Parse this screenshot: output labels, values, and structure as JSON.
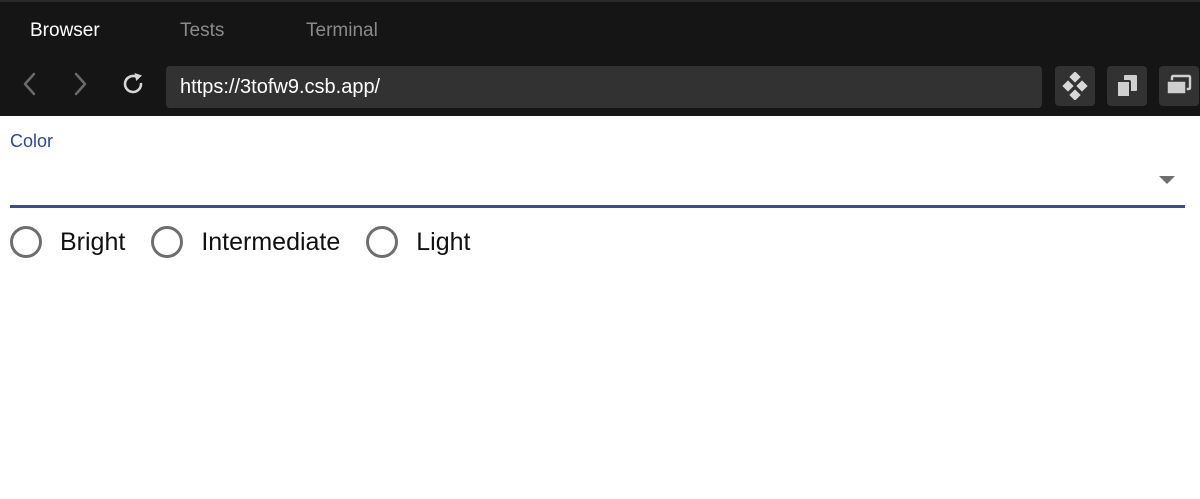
{
  "tabs": {
    "browser": "Browser",
    "tests": "Tests",
    "terminal": "Terminal"
  },
  "navbar": {
    "url": "https://3tofw9.csb.app/"
  },
  "form": {
    "color_label": "Color",
    "select_value": "",
    "radio_options": [
      "Bright",
      "Intermediate",
      "Light"
    ]
  },
  "colors": {
    "accent": "#3949ab",
    "chrome_bg": "#151515",
    "url_bg": "#323232"
  }
}
